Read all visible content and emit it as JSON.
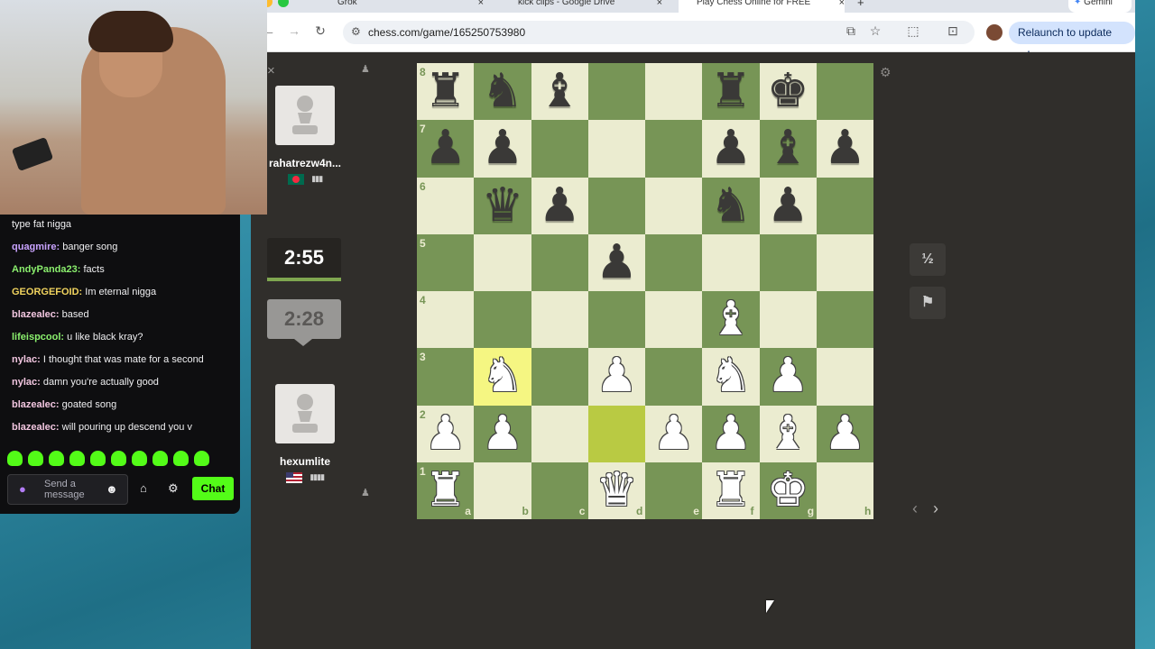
{
  "browser": {
    "tabs": [
      {
        "label": "Grok"
      },
      {
        "label": "kick clips - Google Drive"
      },
      {
        "label": "Play Chess Online for FREE"
      }
    ],
    "gemini_label": "Gemini",
    "url": "chess.com/game/165250753980",
    "relaunch_label": "Relaunch to update"
  },
  "game": {
    "top_player": {
      "name": "rahatrezw4n...",
      "country": "Bangladesh",
      "clock": "2:55"
    },
    "bottom_player": {
      "name": "hexumlite",
      "country": "United States",
      "clock": "2:28"
    },
    "draw_label": "½",
    "flag_icon": "flag-icon",
    "ranks": [
      "8",
      "7",
      "6",
      "5",
      "4",
      "3",
      "2",
      "1"
    ],
    "files": [
      "a",
      "b",
      "c",
      "d",
      "e",
      "f",
      "g",
      "h"
    ],
    "highlight_squares": [
      "b3",
      "d2"
    ],
    "pieces": [
      {
        "sq": "a8",
        "p": "r",
        "c": "b"
      },
      {
        "sq": "b8",
        "p": "n",
        "c": "b"
      },
      {
        "sq": "c8",
        "p": "b",
        "c": "b"
      },
      {
        "sq": "f8",
        "p": "r",
        "c": "b"
      },
      {
        "sq": "g8",
        "p": "k",
        "c": "b"
      },
      {
        "sq": "a7",
        "p": "p",
        "c": "b"
      },
      {
        "sq": "b7",
        "p": "p",
        "c": "b"
      },
      {
        "sq": "f7",
        "p": "p",
        "c": "b"
      },
      {
        "sq": "g7",
        "p": "b",
        "c": "b"
      },
      {
        "sq": "h7",
        "p": "p",
        "c": "b"
      },
      {
        "sq": "b6",
        "p": "q",
        "c": "b"
      },
      {
        "sq": "c6",
        "p": "p",
        "c": "b"
      },
      {
        "sq": "f6",
        "p": "n",
        "c": "b"
      },
      {
        "sq": "g6",
        "p": "p",
        "c": "b"
      },
      {
        "sq": "d5",
        "p": "p",
        "c": "b"
      },
      {
        "sq": "f4",
        "p": "b",
        "c": "w"
      },
      {
        "sq": "b3",
        "p": "n",
        "c": "w"
      },
      {
        "sq": "d3",
        "p": "p",
        "c": "w"
      },
      {
        "sq": "f3",
        "p": "n",
        "c": "w"
      },
      {
        "sq": "g3",
        "p": "p",
        "c": "w"
      },
      {
        "sq": "a2",
        "p": "p",
        "c": "w"
      },
      {
        "sq": "b2",
        "p": "p",
        "c": "w"
      },
      {
        "sq": "e2",
        "p": "p",
        "c": "w"
      },
      {
        "sq": "f2",
        "p": "p",
        "c": "w"
      },
      {
        "sq": "g2",
        "p": "b",
        "c": "w"
      },
      {
        "sq": "h2",
        "p": "p",
        "c": "w"
      },
      {
        "sq": "a1",
        "p": "r",
        "c": "w"
      },
      {
        "sq": "d1",
        "p": "q",
        "c": "w"
      },
      {
        "sq": "f1",
        "p": "r",
        "c": "w"
      },
      {
        "sq": "g1",
        "p": "k",
        "c": "w"
      }
    ],
    "colors": {
      "light": "#ebecd0",
      "dark": "#779556",
      "hl_light": "#f5f682",
      "hl_dark": "#b9ca43"
    }
  },
  "stream_chat": {
    "messages": [
      {
        "user": "",
        "text": "type fat nigga",
        "color": "#efeff1"
      },
      {
        "user": "quagmire:",
        "text": "banger song",
        "color": "#c9a3ff"
      },
      {
        "user": "AndyPanda23:",
        "text": "facts",
        "color": "#8bf06e"
      },
      {
        "user": "GEORGEFOID:",
        "text": "Im eternal nigga",
        "color": "#f0d35e"
      },
      {
        "user": "blazealec:",
        "text": "based",
        "color": "#f2c6e0"
      },
      {
        "user": "lifeispcool:",
        "text": "u like black kray?",
        "color": "#8bf06e"
      },
      {
        "user": "nylac:",
        "text": "I thought that was mate for a second",
        "color": "#f2c6e0"
      },
      {
        "user": "nylac:",
        "text": "damn you're actually good",
        "color": "#f2c6e0"
      },
      {
        "user": "blazealec:",
        "text": "goated song",
        "color": "#f2c6e0"
      },
      {
        "user": "blazealec:",
        "text": "will pouring up descend you v",
        "color": "#f2c6e0"
      }
    ],
    "input_placeholder": "Send a message",
    "chat_button": "Chat"
  }
}
